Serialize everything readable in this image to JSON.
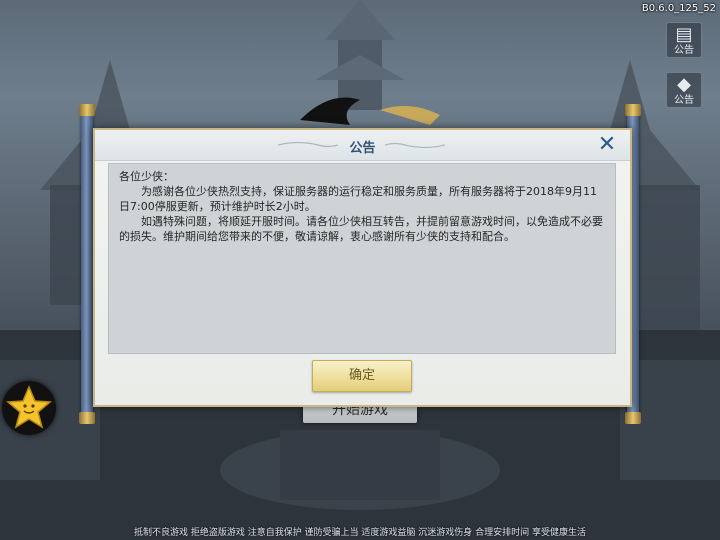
{
  "version": "B0.6.0_125_52",
  "side_buttons": {
    "notice_label": "公告",
    "other_label": "公告"
  },
  "start_button": "开始游戏",
  "footer": "抵制不良游戏 拒绝盗版游戏 注意自我保护 谨防受骗上当 适度游戏益脑 沉迷游戏伤身 合理安排时间 享受健康生活",
  "dialog": {
    "title": "公告",
    "greeting": "各位少侠：",
    "paragraph1": "为感谢各位少侠热烈支持，保证服务器的运行稳定和服务质量，所有服务器将于2018年9月11日7:00停服更新，预计维护时长2小时。",
    "paragraph2": "如遇特殊问题，将顺延开服时间。请各位少侠相互转告，并提前留意游戏时间，以免造成不必要的损失。维护期间给您带来的不便，敬请谅解，衷心感谢所有少侠的支持和配合。",
    "confirm": "确定"
  },
  "colors": {
    "title": "#33507a",
    "confirm_bg": "#efe1a0",
    "dialog_border": "#c9b884"
  }
}
